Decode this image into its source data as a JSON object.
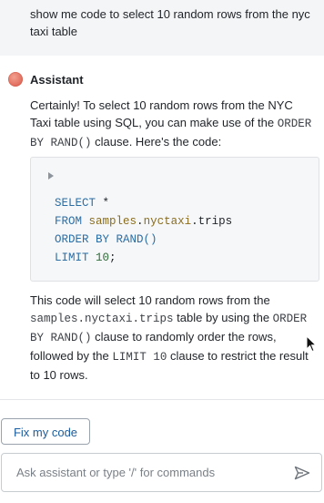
{
  "user_message": "show me code to select 10 random rows from the nyc taxi table",
  "assistant": {
    "name": "Assistant",
    "intro": {
      "text_before": "Certainly! To select 10 random rows from the NYC Taxi table using SQL, you can make use of the ",
      "code": "ORDER BY RAND()",
      "text_after": " clause. Here's the code:"
    },
    "code_block": {
      "line1_kw": "SELECT",
      "line1_rest": " *",
      "line2_kw": "FROM",
      "line2_schema": "samples",
      "line2_dot1": ".",
      "line2_db": "nyctaxi",
      "line2_dot2": ".",
      "line2_table": "trips",
      "line3_kw": "ORDER BY",
      "line3_fn": "RAND()",
      "line4_kw": "LIMIT",
      "line4_num": "10",
      "line4_end": ";"
    },
    "explanation": {
      "p1": "This code will select 10 random rows from the ",
      "c1": "samples.nyctaxi.trips",
      "p2": " table by using the ",
      "c2": "ORDER BY RAND()",
      "p3": " clause to randomly order the rows, followed by the ",
      "c3": "LIMIT 10",
      "p4": " clause to restrict the result to 10 rows."
    }
  },
  "actions": {
    "fix_label": "Fix my code"
  },
  "composer": {
    "placeholder": "Ask assistant or type '/' for commands"
  },
  "colors": {
    "accent": "#1a5c9e",
    "user_bg": "#f4f5f6",
    "code_bg": "#f6f7f8"
  },
  "icons": {
    "run": "play-icon",
    "send": "send-icon",
    "avatar": "assistant-avatar"
  }
}
